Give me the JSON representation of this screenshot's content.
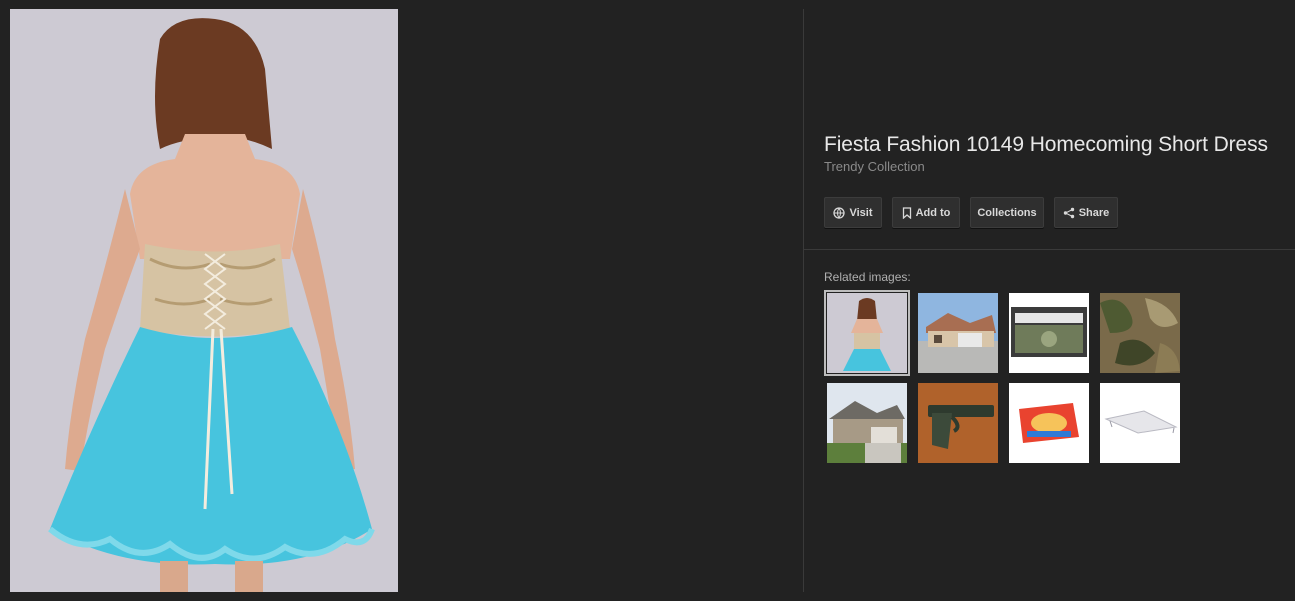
{
  "product": {
    "title": "Fiesta Fashion 10149 Homecoming Short Dress",
    "source": "Trendy Collection"
  },
  "actions": {
    "visit": {
      "label": "Visit",
      "icon": "globe-icon"
    },
    "add_to": {
      "label": "Add to",
      "icon": "bookmark-icon"
    },
    "collections": {
      "label": "Collections"
    },
    "share": {
      "label": "Share",
      "icon": "share-icon"
    }
  },
  "related": {
    "label": "Related images:",
    "thumbnails": [
      {
        "subject": "dress back view",
        "selected": true
      },
      {
        "subject": "house with garage"
      },
      {
        "subject": "graded banknote"
      },
      {
        "subject": "camouflage pattern"
      },
      {
        "subject": "suburban house"
      },
      {
        "subject": "pistol on wood"
      },
      {
        "subject": "fabric softener box"
      },
      {
        "subject": "white canopy"
      }
    ]
  },
  "colors": {
    "background": "#222222",
    "title": "#e8e8e8",
    "subtitle": "#8a8a8a",
    "button_bg": "#2f2f2f"
  }
}
